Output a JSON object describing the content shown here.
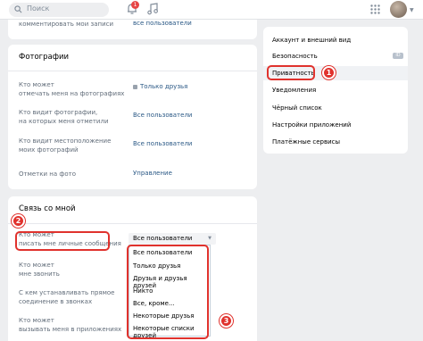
{
  "header": {
    "search_placeholder": "Поиск",
    "notification_count": "1"
  },
  "top_card": {
    "partial_label": "комментировать мои записи",
    "partial_value": "все пользователи"
  },
  "photos": {
    "title": "Фотографии",
    "rows": [
      {
        "label_1": "Кто может",
        "label_2": "отмечать меня на фотографиях",
        "value": "Только друзья",
        "locked": true
      },
      {
        "label_1": "Кто видит фотографии,",
        "label_2": "на которых меня отметили",
        "value": "Все пользователи"
      },
      {
        "label_1": "Кто видит местоположение",
        "label_2": "моих фотографий",
        "value": "Все пользователи"
      },
      {
        "label_1": "Отметки на фото",
        "label_2": "",
        "value": "Управление"
      }
    ]
  },
  "contact": {
    "title": "Связь со мной",
    "rows": [
      {
        "label_1": "Кто может",
        "label_2": "писать мне личные сообщения"
      },
      {
        "label_1": "Кто может",
        "label_2": "мне звонить"
      },
      {
        "label_1": "С кем устанавливать прямое",
        "label_2": "соединение в звонках"
      },
      {
        "label_1": "Кто может",
        "label_2": "вызывать меня в приложениях"
      }
    ],
    "select_value": "Все пользователи",
    "options": [
      "Все пользователи",
      "Только друзья",
      "Друзья и друзья друзей",
      "Никто",
      "Все, кроме...",
      "Некоторые друзья",
      "Некоторые списки друзей"
    ]
  },
  "menu": {
    "items": [
      "Аккаунт и внешний вид",
      "Безопасность",
      "Приватность",
      "Уведомления",
      "Чёрный список",
      "Настройки приложений",
      "Платёжные сервисы"
    ],
    "vk_id_badge": "ID",
    "active_index": 2
  },
  "annotations": [
    "1",
    "2",
    "3"
  ],
  "colors": {
    "accent": "#2a5885",
    "annotation": "#e0322d",
    "background": "#edeef0"
  }
}
